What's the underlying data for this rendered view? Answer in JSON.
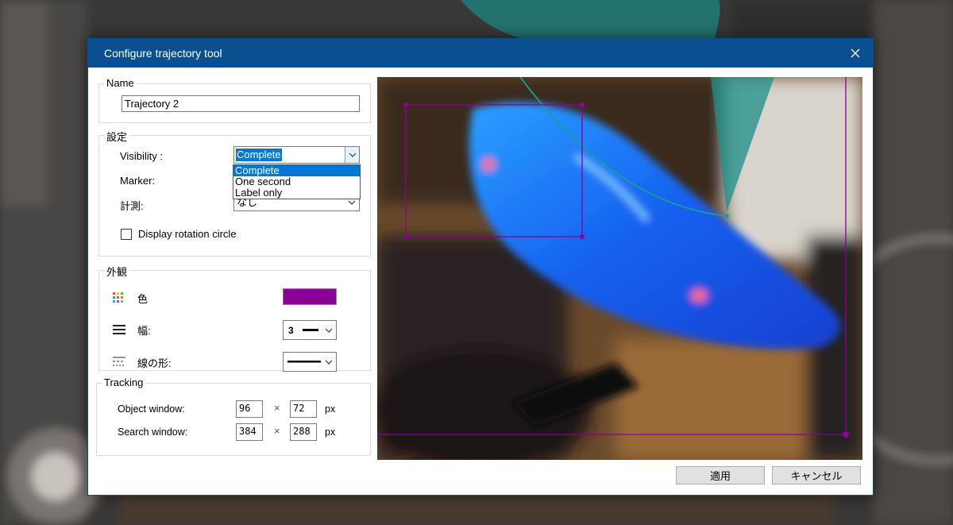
{
  "window": {
    "title": "Configure trajectory tool",
    "close_icon": "close-icon"
  },
  "name_group": {
    "legend": "Name",
    "value": "Trajectory 2"
  },
  "settings_group": {
    "legend": "設定",
    "visibility_label": "Visibility :",
    "visibility_value": "Complete",
    "visibility_options": [
      "Complete",
      "One second",
      "Label only"
    ],
    "marker_label": "Marker:",
    "measure_label": "計測:",
    "measure_value": "なし",
    "rotation_checkbox_label": "Display rotation circle",
    "rotation_checked": false
  },
  "appearance_group": {
    "legend": "外観",
    "color_label": "色",
    "color_value": "#8b0096",
    "width_label": "幅:",
    "width_value": "3",
    "linestyle_label": "線の形:"
  },
  "tracking_group": {
    "legend": "Tracking",
    "object_window_label": "Object window:",
    "object_w": "96",
    "object_h": "72",
    "search_window_label": "Search window:",
    "search_w": "384",
    "search_h": "288",
    "times": "×",
    "unit": "px"
  },
  "buttons": {
    "apply": "適用",
    "cancel": "キャンセル"
  },
  "colors": {
    "titlebar": "#0a4f8f",
    "selection": "#0078d7",
    "trajectory": "#8b0096",
    "angle_tool": "#1a9e97"
  }
}
